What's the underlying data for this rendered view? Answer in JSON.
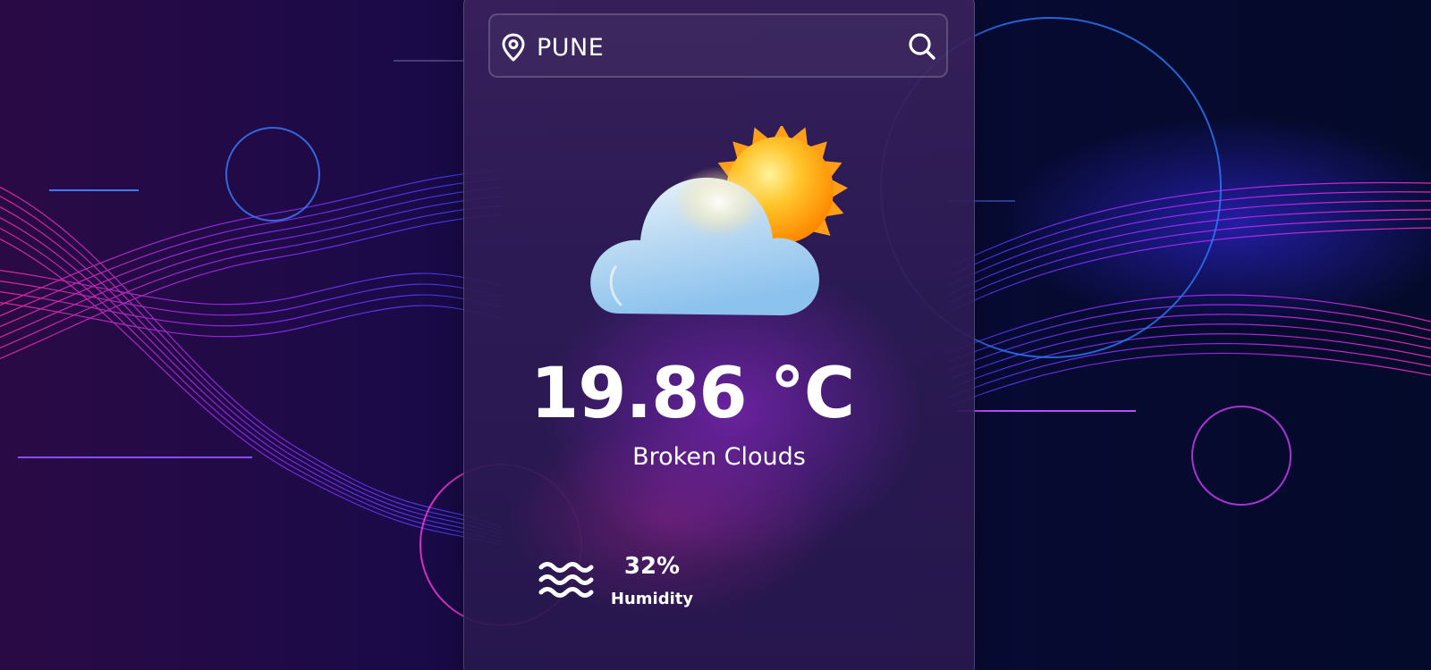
{
  "search": {
    "value": "PUNE",
    "pin_icon": "location-pin-icon",
    "search_icon": "magnifier-icon"
  },
  "weather": {
    "icon": "cloud-sun-icon",
    "temperature": "19.86 °C",
    "description": "Broken Clouds"
  },
  "humidity": {
    "icon": "humidity-waves-icon",
    "value": "32%",
    "label": "Humidity"
  },
  "colors": {
    "accent_pink": "#ff2fa8",
    "accent_blue": "#3b6cff",
    "card_bg": "#2e1c56",
    "text": "#ffffff"
  }
}
